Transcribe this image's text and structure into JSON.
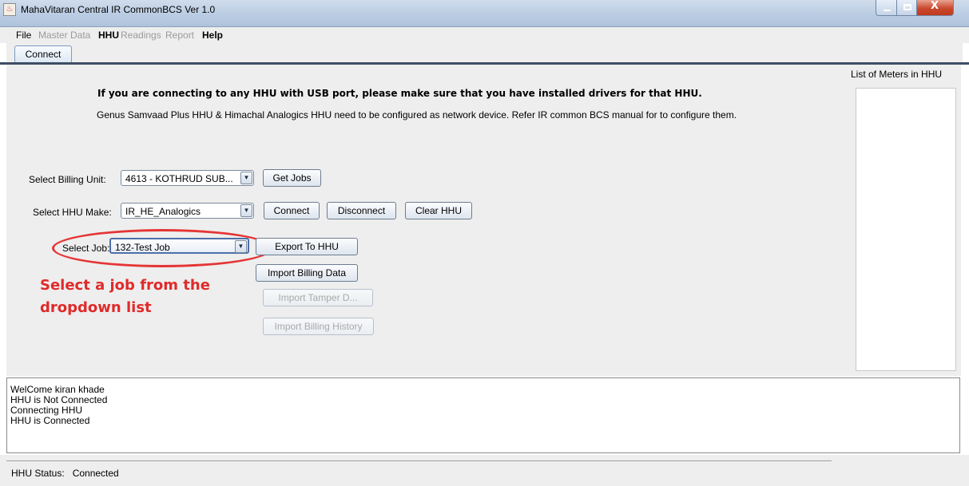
{
  "window": {
    "title": "MahaVitaran Central IR CommonBCS Ver 1.0",
    "close_glyph": "X"
  },
  "menu": {
    "items": [
      {
        "label": "File",
        "enabled": true
      },
      {
        "label": "Master Data",
        "enabled": false
      },
      {
        "label": "HHU",
        "enabled": true
      },
      {
        "label": "Readings",
        "enabled": false
      },
      {
        "label": "Report",
        "enabled": false
      },
      {
        "label": "Help",
        "enabled": true
      }
    ]
  },
  "tabs": [
    {
      "label": "Connect",
      "active": true
    }
  ],
  "connect": {
    "notice_bold": "If you are connecting to any HHU with USB port, please make sure that you have installed drivers for that HHU.",
    "notice": "Genus Samvaad Plus HHU & Himachal Analogics HHU need to be configured as network device. Refer IR common BCS manual for to configure them.",
    "billing_unit": {
      "label": "Select Billing Unit:",
      "value": "4613 - KOTHRUD SUB..."
    },
    "get_jobs_label": "Get Jobs",
    "hhu_make": {
      "label": "Select HHU Make:",
      "value": "IR_HE_Analogics"
    },
    "connect_label": "Connect",
    "disconnect_label": "Disconnect",
    "clear_hhu_label": "Clear HHU",
    "job": {
      "label": "Select Job:",
      "value": "132-Test Job"
    },
    "export_label": "Export To HHU",
    "import_billing_label": "Import Billing Data",
    "import_tamper_label": "Import Tamper D...",
    "import_history_label": "Import Billing History",
    "annotation": "Select a job from the dropdown list",
    "meters_title": "List of Meters in HHU",
    "dropdown_glyph": "▼"
  },
  "log": {
    "lines": [
      "WelCome kiran khade",
      "HHU is Not Connected",
      "Connecting HHU",
      "HHU is Connected"
    ]
  },
  "status": {
    "text": "HHU Status:   Connected"
  },
  "colors": {
    "annotation": "#e02a2a",
    "panel_bg": "#eeeeee",
    "close_button": "#c9492d"
  }
}
